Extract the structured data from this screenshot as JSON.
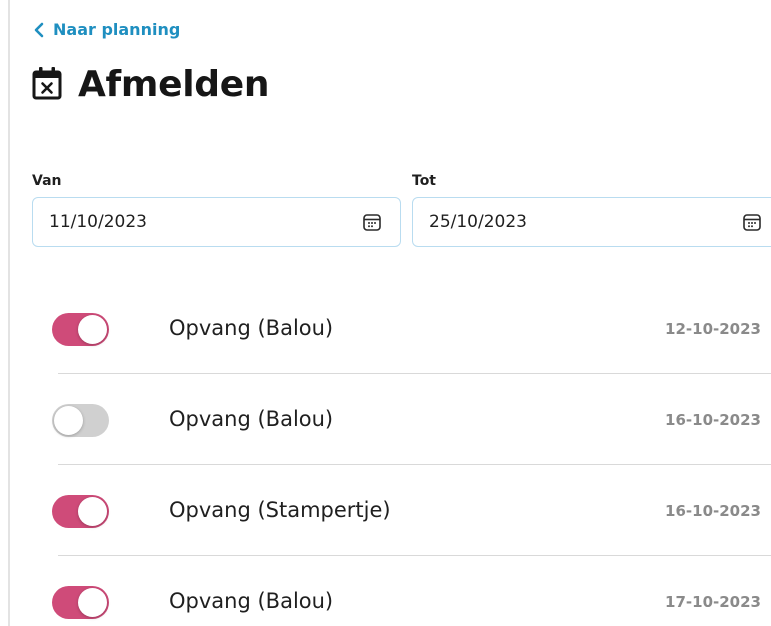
{
  "nav": {
    "back_label": "Naar planning"
  },
  "header": {
    "title": "Afmelden",
    "icon": "calendar-x-icon"
  },
  "date_range": {
    "from": {
      "label": "Van",
      "value": "11/10/2023"
    },
    "to": {
      "label": "Tot",
      "value": "25/10/2023"
    }
  },
  "items": [
    {
      "label": "Opvang (Balou)",
      "date": "12-10-2023",
      "enabled": true
    },
    {
      "label": "Opvang (Balou)",
      "date": "16-10-2023",
      "enabled": false
    },
    {
      "label": "Opvang (Stampertje)",
      "date": "16-10-2023",
      "enabled": true
    },
    {
      "label": "Opvang (Balou)",
      "date": "17-10-2023",
      "enabled": true
    }
  ],
  "colors": {
    "link": "#1f8fc0",
    "toggle_on": "#cf4b79",
    "toggle_off": "#d0d0d0",
    "input_border": "#b9dcf0",
    "date_text": "#8a8a8a"
  }
}
